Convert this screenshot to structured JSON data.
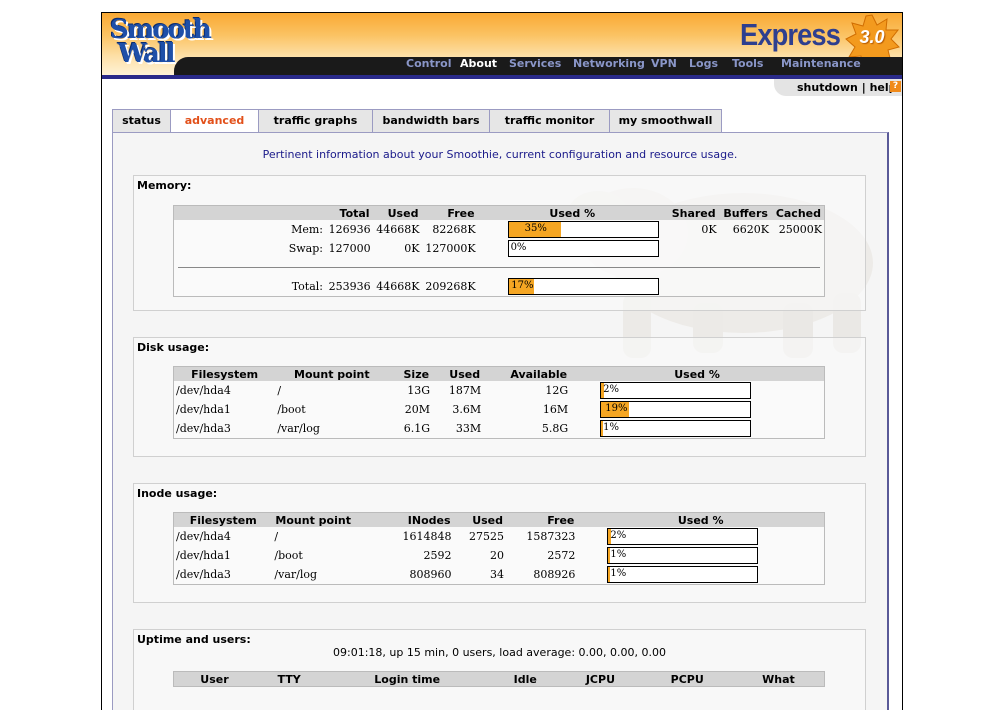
{
  "brand": {
    "logo_line1": "Smooth",
    "logo_line2": "Wall",
    "product": "Express",
    "version": "3.0"
  },
  "nav": [
    "Control",
    "About",
    "Services",
    "Networking",
    "VPN",
    "Logs",
    "Tools",
    "Maintenance"
  ],
  "nav_active": "About",
  "subheader": {
    "links": "shutdown | help",
    "help_icon": "?"
  },
  "tabs": [
    "status",
    "advanced",
    "traffic graphs",
    "bandwidth bars",
    "traffic monitor",
    "my smoothwall"
  ],
  "active_tab": "advanced",
  "intro": "Pertinent information about your Smoothie, current configuration and resource usage.",
  "memory": {
    "title": "Memory:",
    "headers": [
      "",
      "Total",
      "Used",
      "Free",
      "Used %",
      "Shared",
      "Buffers",
      "Cached"
    ],
    "rows": [
      {
        "label": "Mem:",
        "total": "126936",
        "used": "44668K",
        "free": "82268K",
        "pct": 35,
        "pct_label": "35%",
        "shared": "0K",
        "buffers": "6620K",
        "cached": "25000K"
      },
      {
        "label": "Swap:",
        "total": "127000",
        "used": "0K",
        "free": "127000K",
        "pct": 0,
        "pct_label": "0%",
        "shared": "",
        "buffers": "",
        "cached": ""
      }
    ],
    "total": {
      "label": "Total:",
      "total": "253936",
      "used": "44668K",
      "free": "209268K",
      "pct": 17,
      "pct_label": "17%"
    }
  },
  "disk": {
    "title": "Disk usage:",
    "headers": [
      "Filesystem",
      "Mount point",
      "Size",
      "Used",
      "Available",
      "Used %"
    ],
    "rows": [
      {
        "fs": "/dev/hda4",
        "mount": "/",
        "size": "13G",
        "used": "187M",
        "avail": "12G",
        "pct": 2,
        "pct_label": "2%"
      },
      {
        "fs": "/dev/hda1",
        "mount": "/boot",
        "size": "20M",
        "used": "3.6M",
        "avail": "16M",
        "pct": 19,
        "pct_label": "19%"
      },
      {
        "fs": "/dev/hda3",
        "mount": "/var/log",
        "size": "6.1G",
        "used": "33M",
        "avail": "5.8G",
        "pct": 1,
        "pct_label": "1%"
      }
    ]
  },
  "inode": {
    "title": "Inode usage:",
    "headers": [
      "Filesystem",
      "Mount point",
      "INodes",
      "Used",
      "Free",
      "Used %"
    ],
    "rows": [
      {
        "fs": "/dev/hda4",
        "mount": "/",
        "inodes": "1614848",
        "used": "27525",
        "free": "1587323",
        "pct": 2,
        "pct_label": "2%"
      },
      {
        "fs": "/dev/hda1",
        "mount": "/boot",
        "inodes": "2592",
        "used": "20",
        "free": "2572",
        "pct": 1,
        "pct_label": "1%"
      },
      {
        "fs": "/dev/hda3",
        "mount": "/var/log",
        "inodes": "808960",
        "used": "34",
        "free": "808926",
        "pct": 1,
        "pct_label": "1%"
      }
    ]
  },
  "uptime": {
    "title": "Uptime and users:",
    "summary": "09:01:18, up 15 min, 0 users, load average: 0.00, 0.00, 0.00",
    "headers": [
      "User",
      "TTY",
      "Login time",
      "Idle",
      "JCPU",
      "PCPU",
      "What"
    ]
  },
  "colors": {
    "accent": "#f5a623",
    "nav_dark": "#1a1a1a",
    "brand_blue": "#2e3f8f",
    "tab_active": "#e2501a",
    "intro_text": "#1a1a8a"
  }
}
